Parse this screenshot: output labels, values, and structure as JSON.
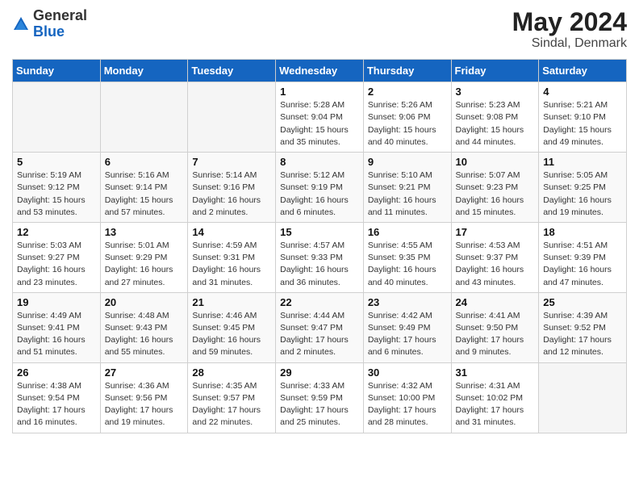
{
  "header": {
    "logo_general": "General",
    "logo_blue": "Blue",
    "month_year": "May 2024",
    "location": "Sindal, Denmark"
  },
  "days_of_week": [
    "Sunday",
    "Monday",
    "Tuesday",
    "Wednesday",
    "Thursday",
    "Friday",
    "Saturday"
  ],
  "weeks": [
    [
      {
        "day": "",
        "info": ""
      },
      {
        "day": "",
        "info": ""
      },
      {
        "day": "",
        "info": ""
      },
      {
        "day": "1",
        "info": "Sunrise: 5:28 AM\nSunset: 9:04 PM\nDaylight: 15 hours\nand 35 minutes."
      },
      {
        "day": "2",
        "info": "Sunrise: 5:26 AM\nSunset: 9:06 PM\nDaylight: 15 hours\nand 40 minutes."
      },
      {
        "day": "3",
        "info": "Sunrise: 5:23 AM\nSunset: 9:08 PM\nDaylight: 15 hours\nand 44 minutes."
      },
      {
        "day": "4",
        "info": "Sunrise: 5:21 AM\nSunset: 9:10 PM\nDaylight: 15 hours\nand 49 minutes."
      }
    ],
    [
      {
        "day": "5",
        "info": "Sunrise: 5:19 AM\nSunset: 9:12 PM\nDaylight: 15 hours\nand 53 minutes."
      },
      {
        "day": "6",
        "info": "Sunrise: 5:16 AM\nSunset: 9:14 PM\nDaylight: 15 hours\nand 57 minutes."
      },
      {
        "day": "7",
        "info": "Sunrise: 5:14 AM\nSunset: 9:16 PM\nDaylight: 16 hours\nand 2 minutes."
      },
      {
        "day": "8",
        "info": "Sunrise: 5:12 AM\nSunset: 9:19 PM\nDaylight: 16 hours\nand 6 minutes."
      },
      {
        "day": "9",
        "info": "Sunrise: 5:10 AM\nSunset: 9:21 PM\nDaylight: 16 hours\nand 11 minutes."
      },
      {
        "day": "10",
        "info": "Sunrise: 5:07 AM\nSunset: 9:23 PM\nDaylight: 16 hours\nand 15 minutes."
      },
      {
        "day": "11",
        "info": "Sunrise: 5:05 AM\nSunset: 9:25 PM\nDaylight: 16 hours\nand 19 minutes."
      }
    ],
    [
      {
        "day": "12",
        "info": "Sunrise: 5:03 AM\nSunset: 9:27 PM\nDaylight: 16 hours\nand 23 minutes."
      },
      {
        "day": "13",
        "info": "Sunrise: 5:01 AM\nSunset: 9:29 PM\nDaylight: 16 hours\nand 27 minutes."
      },
      {
        "day": "14",
        "info": "Sunrise: 4:59 AM\nSunset: 9:31 PM\nDaylight: 16 hours\nand 31 minutes."
      },
      {
        "day": "15",
        "info": "Sunrise: 4:57 AM\nSunset: 9:33 PM\nDaylight: 16 hours\nand 36 minutes."
      },
      {
        "day": "16",
        "info": "Sunrise: 4:55 AM\nSunset: 9:35 PM\nDaylight: 16 hours\nand 40 minutes."
      },
      {
        "day": "17",
        "info": "Sunrise: 4:53 AM\nSunset: 9:37 PM\nDaylight: 16 hours\nand 43 minutes."
      },
      {
        "day": "18",
        "info": "Sunrise: 4:51 AM\nSunset: 9:39 PM\nDaylight: 16 hours\nand 47 minutes."
      }
    ],
    [
      {
        "day": "19",
        "info": "Sunrise: 4:49 AM\nSunset: 9:41 PM\nDaylight: 16 hours\nand 51 minutes."
      },
      {
        "day": "20",
        "info": "Sunrise: 4:48 AM\nSunset: 9:43 PM\nDaylight: 16 hours\nand 55 minutes."
      },
      {
        "day": "21",
        "info": "Sunrise: 4:46 AM\nSunset: 9:45 PM\nDaylight: 16 hours\nand 59 minutes."
      },
      {
        "day": "22",
        "info": "Sunrise: 4:44 AM\nSunset: 9:47 PM\nDaylight: 17 hours\nand 2 minutes."
      },
      {
        "day": "23",
        "info": "Sunrise: 4:42 AM\nSunset: 9:49 PM\nDaylight: 17 hours\nand 6 minutes."
      },
      {
        "day": "24",
        "info": "Sunrise: 4:41 AM\nSunset: 9:50 PM\nDaylight: 17 hours\nand 9 minutes."
      },
      {
        "day": "25",
        "info": "Sunrise: 4:39 AM\nSunset: 9:52 PM\nDaylight: 17 hours\nand 12 minutes."
      }
    ],
    [
      {
        "day": "26",
        "info": "Sunrise: 4:38 AM\nSunset: 9:54 PM\nDaylight: 17 hours\nand 16 minutes."
      },
      {
        "day": "27",
        "info": "Sunrise: 4:36 AM\nSunset: 9:56 PM\nDaylight: 17 hours\nand 19 minutes."
      },
      {
        "day": "28",
        "info": "Sunrise: 4:35 AM\nSunset: 9:57 PM\nDaylight: 17 hours\nand 22 minutes."
      },
      {
        "day": "29",
        "info": "Sunrise: 4:33 AM\nSunset: 9:59 PM\nDaylight: 17 hours\nand 25 minutes."
      },
      {
        "day": "30",
        "info": "Sunrise: 4:32 AM\nSunset: 10:00 PM\nDaylight: 17 hours\nand 28 minutes."
      },
      {
        "day": "31",
        "info": "Sunrise: 4:31 AM\nSunset: 10:02 PM\nDaylight: 17 hours\nand 31 minutes."
      },
      {
        "day": "",
        "info": ""
      }
    ]
  ]
}
